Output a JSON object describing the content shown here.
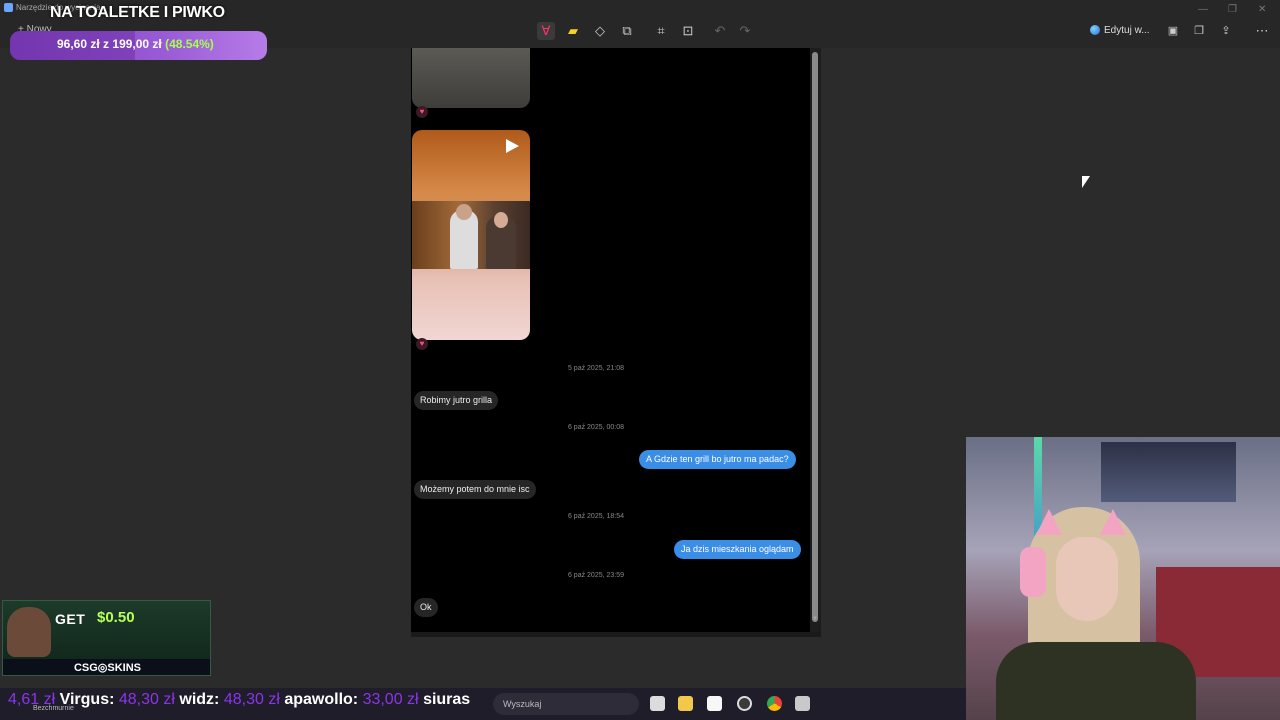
{
  "window": {
    "app_title": "Narzędzie do wycinania",
    "new_button": "+ Nowy",
    "edit_label": "Edytuj w...",
    "toolbar_icons": [
      "pen-icon",
      "highlighter-icon",
      "eraser-icon",
      "shapes-icon",
      "crop-icon",
      "text-actions-icon",
      "undo-icon",
      "redo-icon"
    ],
    "right_icons": [
      "save-icon",
      "copy-icon",
      "share-icon",
      "more-icon"
    ]
  },
  "overlay": {
    "goal_title": "NA TOALETKE I PIWKO",
    "goal_current": "96,60 zł",
    "goal_separator": "z",
    "goal_total": "199,00 zł",
    "goal_percent_text": "(48.54%)",
    "goal_progress": 0.4854
  },
  "chat": {
    "messages": [
      {
        "kind": "timestamp",
        "text": "5 paź 2025, 21:08"
      },
      {
        "kind": "incoming",
        "text": "Robimy jutro grilla"
      },
      {
        "kind": "timestamp",
        "text": "6 paź 2025, 00:08"
      },
      {
        "kind": "outgoing",
        "text": "A Gdzie ten grill bo jutro ma padac?"
      },
      {
        "kind": "incoming",
        "text": "Możemy potem do mnie isc"
      },
      {
        "kind": "timestamp",
        "text": "6 paź 2025, 18:54"
      },
      {
        "kind": "outgoing",
        "text": "Ja dzis mieszkania oglądam"
      },
      {
        "kind": "timestamp",
        "text": "6 paź 2025, 23:59"
      },
      {
        "kind": "incoming",
        "text": "Ok"
      }
    ],
    "reaction_icon": "heart-icon"
  },
  "ad": {
    "get_text": "GET",
    "amount": "$0.50",
    "brand": "CSG◎SKINS"
  },
  "ticker": {
    "prefix_amount": "4,61 zł",
    "entries": [
      {
        "name": "Virgus:",
        "amount": "48,30 zł"
      },
      {
        "name": "widz:",
        "amount": "48,30 zł"
      },
      {
        "name": "apawollo:",
        "amount": "33,00 zł"
      },
      {
        "name": "siuras",
        "amount": ""
      }
    ],
    "sub_label": "Bezchmurnie"
  },
  "taskbar": {
    "search_placeholder": "Wyszukaj",
    "icons": [
      "task-view-icon",
      "file-explorer-icon",
      "store-icon",
      "clock-app-icon",
      "chrome-icon",
      "app-icon"
    ]
  },
  "colors": {
    "accent_purple": "#8b35e8",
    "goal_green": "#a6ff4d",
    "bubble_blue": "#3a8ee6"
  }
}
